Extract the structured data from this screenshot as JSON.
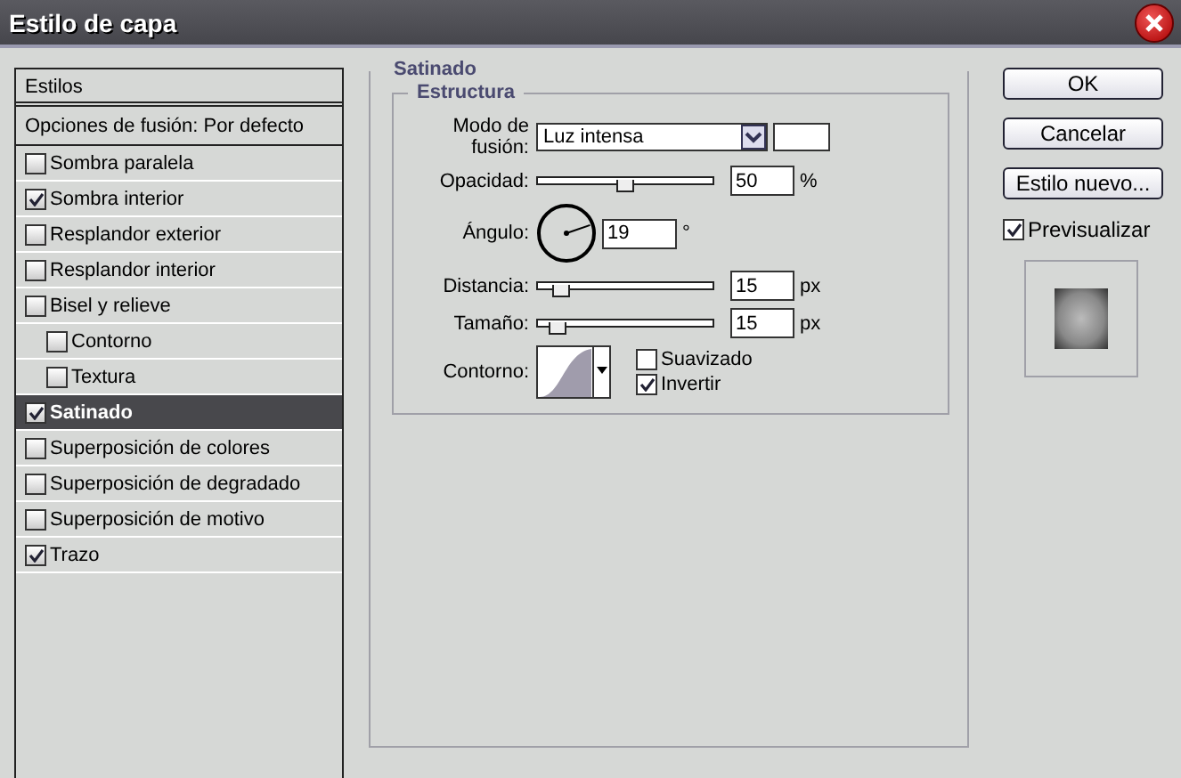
{
  "window": {
    "title": "Estilo de capa"
  },
  "styles_panel": {
    "header": "Estilos",
    "blending_options": "Opciones de fusión: Por defecto",
    "items": [
      {
        "label": "Sombra paralela",
        "checked": false,
        "selected": false
      },
      {
        "label": "Sombra interior",
        "checked": true,
        "selected": false
      },
      {
        "label": "Resplandor exterior",
        "checked": false,
        "selected": false
      },
      {
        "label": "Resplandor interior",
        "checked": false,
        "selected": false
      },
      {
        "label": "Bisel y relieve",
        "checked": false,
        "selected": false,
        "children": [
          {
            "label": "Contorno",
            "checked": false,
            "selected": false
          },
          {
            "label": "Textura",
            "checked": false,
            "selected": false
          }
        ]
      },
      {
        "label": "Satinado",
        "checked": true,
        "selected": true
      },
      {
        "label": "Superposición de colores",
        "checked": false,
        "selected": false
      },
      {
        "label": "Superposición de degradado",
        "checked": false,
        "selected": false
      },
      {
        "label": "Superposición de motivo",
        "checked": false,
        "selected": false
      },
      {
        "label": "Trazo",
        "checked": true,
        "selected": false
      }
    ]
  },
  "section": {
    "title": "Satinado",
    "group": "Estructura",
    "blend_mode": {
      "label": "Modo de fusión:",
      "value": "Luz intensa"
    },
    "opacity": {
      "label": "Opacidad:",
      "value": "50",
      "unit": "%",
      "level": 0.5
    },
    "angle": {
      "label": "Ángulo:",
      "value": "19",
      "unit": "°"
    },
    "distance": {
      "label": "Distancia:",
      "value": "15",
      "unit": "px",
      "level": 0.13
    },
    "size": {
      "label": "Tamaño:",
      "value": "15",
      "unit": "px",
      "level": 0.11
    },
    "contour": {
      "label": "Contorno:"
    },
    "options": [
      {
        "label": "Suavizado",
        "checked": false
      },
      {
        "label": "Invertir",
        "checked": true
      }
    ]
  },
  "buttons": [
    "OK",
    "Cancelar",
    "Estilo nuevo..."
  ],
  "preview": {
    "label": "Previsualizar",
    "checked": true
  }
}
